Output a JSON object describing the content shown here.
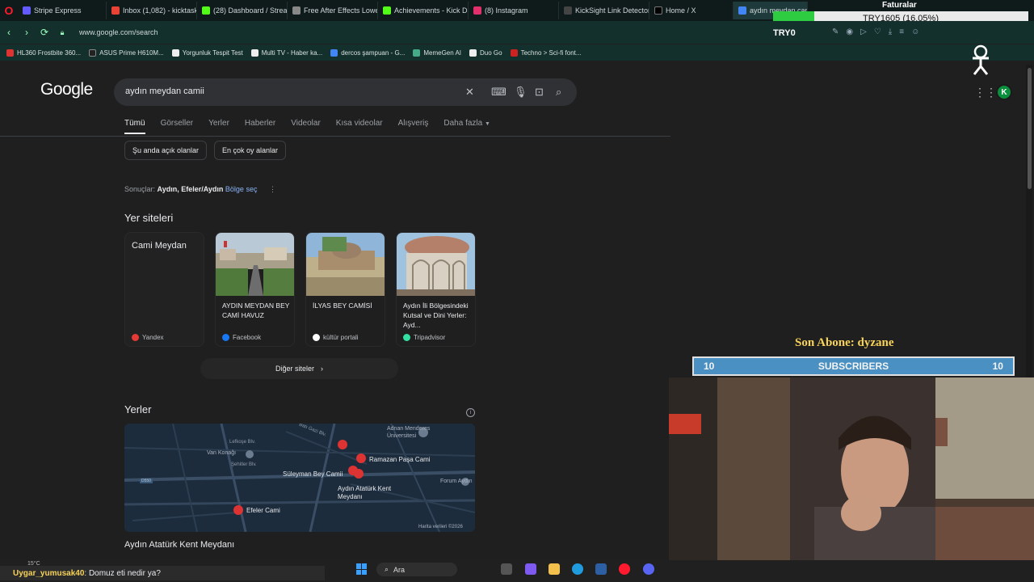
{
  "browser": {
    "tabs": [
      {
        "label": "Stripe Express",
        "color": "#635bff"
      },
      {
        "label": "Inbox (1,082) - kicktaskin",
        "color": "#ea4335"
      },
      {
        "label": "(28) Dashboard / Streamla",
        "color": "#53fc18"
      },
      {
        "label": "Free After Effects Lower Th",
        "color": "#888888"
      },
      {
        "label": "Achievements - Kick Dash",
        "color": "#53fc18"
      },
      {
        "label": "(8) Instagram",
        "color": "#e1306c"
      },
      {
        "label": "KickSight Link Detector",
        "color": "#444444"
      },
      {
        "label": "Home / X",
        "color": "#000000"
      },
      {
        "label": "aydın meydan camii - Goo",
        "color": "#4285f4"
      }
    ],
    "url": "www.google.com/search",
    "bookmarks": [
      {
        "label": "HL360 Frostbite 360...",
        "color": "#d33"
      },
      {
        "label": "ASUS Prime H610M...",
        "color": "#222"
      },
      {
        "label": "Yorgunluk Tespit Test",
        "color": "#eee"
      },
      {
        "label": "Multi TV - Haber ka...",
        "color": "#eee"
      },
      {
        "label": "dercos şampuan - G...",
        "color": "#4285f4"
      },
      {
        "label": "MemeGen AI",
        "color": "#4a8"
      },
      {
        "label": "Duo Go",
        "color": "#eee"
      },
      {
        "label": "Techno > Sci-fi font...",
        "color": "#c22"
      }
    ]
  },
  "widget": {
    "faturalar": "Faturalar",
    "progress_text": "TRY1605 (16.05%)",
    "progress_fraction": 0.1605,
    "try0": "TRY0"
  },
  "google": {
    "logo": "Google",
    "query": "aydın meydan camii",
    "tabs": [
      "Tümü",
      "Görseller",
      "Yerler",
      "Haberler",
      "Videolar",
      "Kısa videolar",
      "Alışveriş",
      "Daha fazla"
    ],
    "chips": [
      "Şu anda açık olanlar",
      "En çok oy alanlar"
    ],
    "results_prefix": "Sonuçlar:",
    "results_location": "Aydın, Efeler/Aydın",
    "results_change": "Bölge seç",
    "sites_title": "Yer siteleri",
    "cards": [
      {
        "caption": "Cami Meydan",
        "source": "Yandex",
        "src_color": "#e53935"
      },
      {
        "caption": "AYDIN MEYDAN BEY CAMİ HAVUZ",
        "source": "Facebook",
        "src_color": "#1877f2"
      },
      {
        "caption": "İLYAS BEY CAMİSİ",
        "source": "kültür portali",
        "src_color": "#ffffff"
      },
      {
        "caption": "Aydın İli Bölgesindeki Kutsal ve Dini Yerler: Ayd...",
        "source": "Tripadvisor",
        "src_color": "#34e0a1"
      }
    ],
    "other_sites": "Diğer siteler",
    "places_title": "Yerler",
    "map_labels": {
      "adnan": "Adnan Menderes Üniversitesi",
      "batigazi": "Batı Gazi Blv.",
      "lefkose": "Lefkoşe Blv.",
      "vankonagi": "Van Konağı",
      "sehitler": "Şehitler Blv.",
      "ramazan": "Ramazan Paşa Cami",
      "suleyman": "Süleyman Bey Camii",
      "kentmeydani": "Aydın Atatürk Kent Meydanı",
      "forum": "Forum Aydın",
      "efeler": "Efeler Cami",
      "d550": "D550",
      "credit": "Harita verileri ©2026"
    },
    "place_name": "Aydın Atatürk Kent Meydanı"
  },
  "overlay": {
    "sub_title": "Son Abone: dyzane",
    "sub_label": "SUBSCRIBERS",
    "sub_left": "10",
    "sub_right": "10"
  },
  "taskbar": {
    "temp": "15°C",
    "chat_user": "Uygar_yumusak40",
    "chat_message": ": Domuz eti nedir ya?",
    "search_label": "Ara"
  }
}
